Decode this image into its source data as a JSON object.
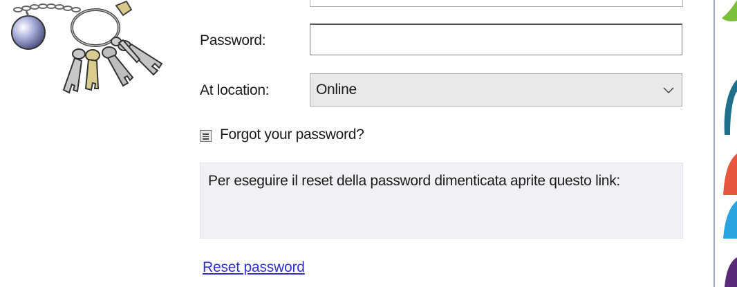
{
  "form": {
    "password_label": "Password:",
    "password_value": "",
    "location_label": "At location:",
    "location_value": "Online",
    "forgot_label": "Forgot your password?",
    "info_text": "Per eseguire il reset della password dimenticata aprite questo link:",
    "reset_link_label": "Reset password"
  },
  "icons": {
    "logo": "keyring-icon",
    "dropdown": "chevron-down-icon",
    "toggle": "collapse-toggle-icon"
  },
  "colors": {
    "link": "#3333cc",
    "info_panel_bg": "#f0f0f5",
    "select_bg": "#e9e9e9",
    "desktop_green": "#7bbf3a",
    "desktop_teal": "#1f6f8b",
    "desktop_red": "#e8563f",
    "desktop_blue": "#2aa3e0",
    "desktop_purple": "#5a2a7a"
  }
}
